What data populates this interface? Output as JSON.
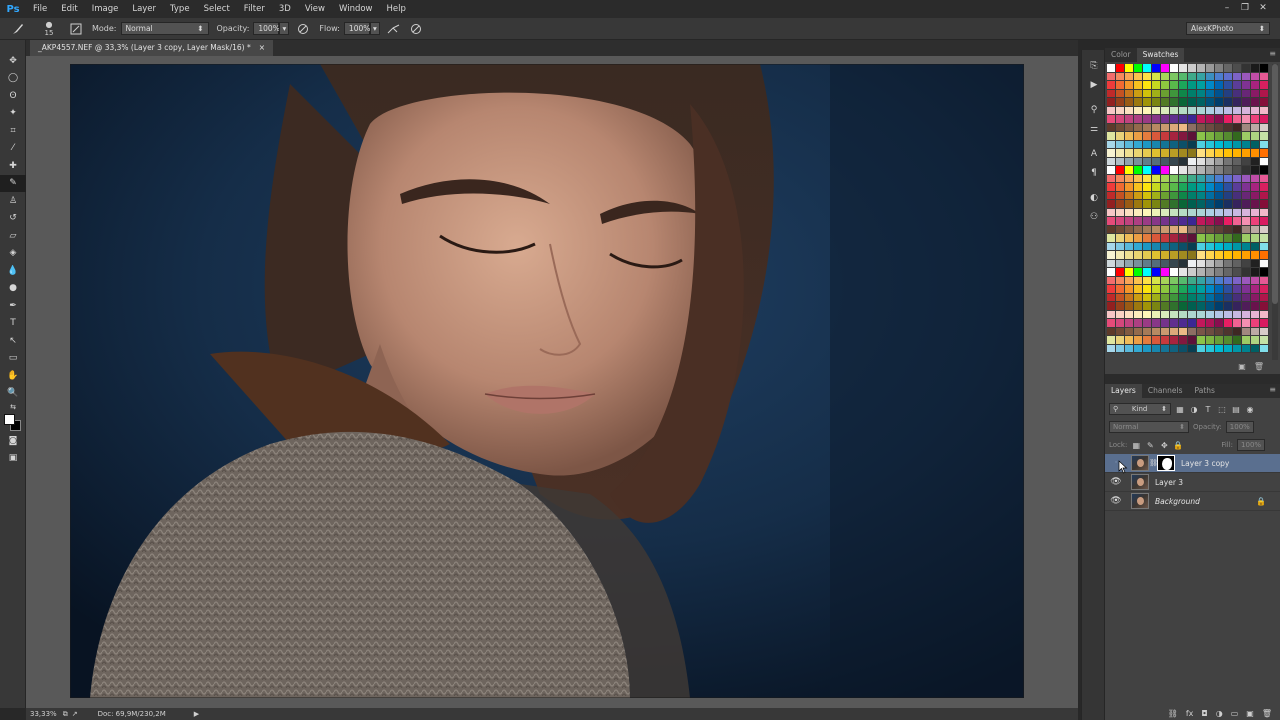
{
  "app": {
    "logo": "Ps"
  },
  "menu": [
    "File",
    "Edit",
    "Image",
    "Layer",
    "Type",
    "Select",
    "Filter",
    "3D",
    "View",
    "Window",
    "Help"
  ],
  "window_controls": [
    "–",
    "❐",
    "✕"
  ],
  "options_bar": {
    "brush_size": "15",
    "mode_label": "Mode:",
    "mode_value": "Normal",
    "opacity_label": "Opacity:",
    "opacity_value": "100%",
    "flow_label": "Flow:",
    "flow_value": "100%",
    "workspace": "AlexKPhoto"
  },
  "document_tab": {
    "title": "_AKP4557.NEF @ 33,3% (Layer 3 copy, Layer Mask/16) *",
    "close": "×"
  },
  "status_bar": {
    "zoom": "33,33%",
    "doc_info": "Doc: 69,9M/230,2M",
    "arrow": "▶"
  },
  "color_panel": {
    "tabs": [
      "Color",
      "Swatches"
    ],
    "active_tab": "Swatches"
  },
  "layers_panel": {
    "tabs": [
      "Layers",
      "Channels",
      "Paths"
    ],
    "active_tab": "Layers",
    "filter_kind": "Kind",
    "blend_mode": "Normal",
    "opacity_label": "Opacity:",
    "opacity_value": "100%",
    "lock_label": "Lock:",
    "fill_label": "Fill:",
    "fill_value": "100%",
    "layers": [
      {
        "name": "Layer 3 copy",
        "visible": false,
        "has_mask": true,
        "selected": true
      },
      {
        "name": "Layer 3",
        "visible": true,
        "has_mask": false,
        "selected": false
      },
      {
        "name": "Background",
        "visible": true,
        "has_mask": false,
        "selected": false,
        "locked": true
      }
    ]
  },
  "colors": {
    "accent": "#31a8ff",
    "selected_layer": "#5a6f8f",
    "canvas_bg": "#595959",
    "panel_bg": "#424242",
    "foreground": "#ffffff",
    "background": "#000000"
  },
  "swatches": [
    "#ffffff",
    "#ff0000",
    "#ffff00",
    "#00ff00",
    "#00ffff",
    "#0000ff",
    "#ff00ff",
    "#ffffff",
    "#e5e5e5",
    "#cccccc",
    "#b3b3b3",
    "#999999",
    "#808080",
    "#666666",
    "#4d4d4d",
    "#333333",
    "#1a1a1a",
    "#000000",
    "#f26c6c",
    "#f5895f",
    "#f8a556",
    "#fbc24d",
    "#fde146",
    "#d6e449",
    "#a6d459",
    "#7dc763",
    "#55b96d",
    "#3ea98a",
    "#35a3a3",
    "#3b8fc1",
    "#4c7ed0",
    "#5f6fcf",
    "#7d63c7",
    "#9b58bc",
    "#c04da7",
    "#e55994",
    "#ee3b3b",
    "#f06a32",
    "#f3962a",
    "#f7c21f",
    "#fce40f",
    "#c6d820",
    "#8dc73f",
    "#59b94b",
    "#1ca65a",
    "#009a83",
    "#00a0a0",
    "#0089c8",
    "#0066b3",
    "#2d4fa0",
    "#5b3d99",
    "#7f3293",
    "#a8237f",
    "#d7205f",
    "#c02a2a",
    "#c45223",
    "#c8771c",
    "#cc9d13",
    "#d1c10b",
    "#a0af18",
    "#6ba131",
    "#3f963c",
    "#0f8749",
    "#007f6b",
    "#008383",
    "#006ea4",
    "#00528f",
    "#233f81",
    "#482f7b",
    "#682776",
    "#8a1a65",
    "#af164b",
    "#922020",
    "#96401b",
    "#995b15",
    "#9c780f",
    "#a09408",
    "#7a8512",
    "#527a25",
    "#30712d",
    "#0a6637",
    "#005f50",
    "#006363",
    "#00537b",
    "#003e6c",
    "#1a2f61",
    "#36235d",
    "#4f1d59",
    "#69134c",
    "#850f38",
    "#f7c6c6",
    "#f8d3c3",
    "#fbe0c0",
    "#fcecbc",
    "#fef6b8",
    "#ecf2b6",
    "#d8ebbb",
    "#c6e3bf",
    "#b5dcc4",
    "#aed6cf",
    "#abd5d5",
    "#add0e4",
    "#b3c6e6",
    "#bcbde5",
    "#c8b8e1",
    "#d7b4dc",
    "#e7b3d2",
    "#f3b8c8",
    "#e64b79",
    "#d3477c",
    "#c0437f",
    "#ad3f82",
    "#9a3b85",
    "#873788",
    "#74338b",
    "#612f8e",
    "#4e2b91",
    "#3b2794",
    "#c2185b",
    "#ad1457",
    "#880e4f",
    "#e91e63",
    "#f06292",
    "#f48fb1",
    "#ec407a",
    "#d81b60",
    "#5d3a2a",
    "#6f4a35",
    "#815a41",
    "#936a4c",
    "#a57a58",
    "#b78a63",
    "#c99a6f",
    "#dbaa7a",
    "#ecba86",
    "#8d6e63",
    "#795548",
    "#6d4c41",
    "#5d4037",
    "#4e342e",
    "#3e2723",
    "#a1887f",
    "#bcaaa4",
    "#d7ccc8",
    "#dfe6a0",
    "#e9d27a",
    "#efbb58",
    "#eb9e45",
    "#e47c3e",
    "#d9593b",
    "#c63a3d",
    "#a6243f",
    "#82183f",
    "#5c1238",
    "#8bc34a",
    "#7cb342",
    "#689f38",
    "#558b2f",
    "#33691e",
    "#9ccc65",
    "#aed581",
    "#c5e1a5",
    "#a7d7ea",
    "#80c8e2",
    "#59b8da",
    "#33a9d2",
    "#1d98c4",
    "#1886ad",
    "#147496",
    "#10627f",
    "#0c5068",
    "#083e51",
    "#4dd0e1",
    "#26c6da",
    "#00bcd4",
    "#00acc1",
    "#0097a7",
    "#00838f",
    "#006064",
    "#80deea",
    "#f8f3d2",
    "#f3e9b2",
    "#eedf91",
    "#e9d571",
    "#e4cb50",
    "#dfc130",
    "#d0b02a",
    "#b99d25",
    "#a28a20",
    "#8b771b",
    "#ffe082",
    "#ffd54f",
    "#ffca28",
    "#ffc107",
    "#ffb300",
    "#ffa000",
    "#ff8f00",
    "#ff6f00",
    "#cfd8dc",
    "#b0bec5",
    "#90a4ae",
    "#78909c",
    "#607d8b",
    "#546e7a",
    "#455a64",
    "#37474f",
    "#263238",
    "#eceff1",
    "#e0e0e0",
    "#bdbdbd",
    "#9e9e9e",
    "#757575",
    "#616161",
    "#424242",
    "#212121",
    "#fafafa"
  ]
}
